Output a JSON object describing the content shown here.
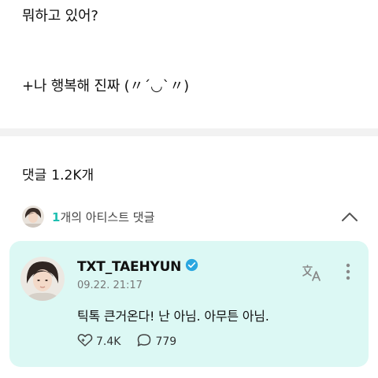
{
  "post": {
    "line1": "뭐하고 있어?",
    "line2": "+나 행복해 진짜 (〃´◡`〃)"
  },
  "comments_header": {
    "label": "댓글",
    "count": "1.2K개"
  },
  "artist_comments": {
    "count": "1",
    "label": "개의 아티스트 댓글",
    "toggle_icon": "chevron-up-icon"
  },
  "comment": {
    "author": "TXT_TAEHYUN",
    "verified_icon": "verified-badge-icon",
    "timestamp": "09.22. 21:17",
    "text": "틱톡 큰거온다! 난 아님. 아무튼 아님.",
    "likes": "7.4K",
    "replies": "779",
    "translate_icon": "translate-icon",
    "more_icon": "more-vertical-icon"
  },
  "colors": {
    "accent": "#1fbfb1",
    "card_background": "#dcf8f4",
    "verified": "#2aa7e0"
  }
}
